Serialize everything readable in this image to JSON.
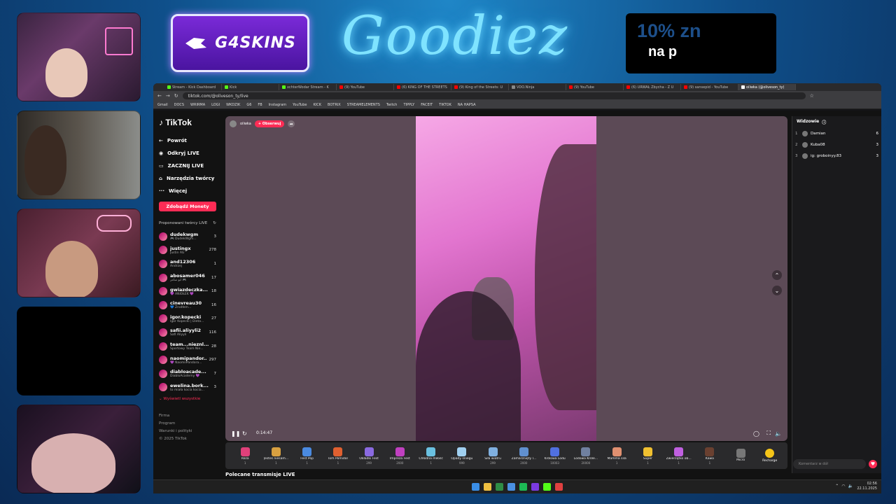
{
  "sponsor": {
    "brand": "G4SKINS"
  },
  "banner": {
    "title": "Goodiez"
  },
  "promo": {
    "line1": "10% zn",
    "line2": "na p"
  },
  "browser": {
    "tabs": [
      {
        "label": "Stream - Kick Dashboard",
        "color": "#53fc18"
      },
      {
        "label": "Kick",
        "color": "#53fc18"
      },
      {
        "label": "xchterWodar Stream - K",
        "color": "#53fc18"
      },
      {
        "label": "(9) YouTube",
        "color": "#ff0000"
      },
      {
        "label": "(6) KING OF THE STREETS",
        "color": "#ff0000"
      },
      {
        "label": "(9) King of the Streets: U",
        "color": "#ff0000"
      },
      {
        "label": "VDO.Ninja",
        "color": "#888888"
      },
      {
        "label": "(9) YouTube",
        "color": "#ff0000"
      },
      {
        "label": "(6) URWAŁ Zbycha - Z U",
        "color": "#ff0000"
      },
      {
        "label": "(9) sansepid - YouTube",
        "color": "#ff0000"
      },
      {
        "label": "oilwka (@oliveson_ty)",
        "color": "#ffffff",
        "active": true
      }
    ],
    "url": "tiktok.com/@oliveson_ty/live",
    "bookmarks": [
      "Gmail",
      "DOCS",
      "WRIRMA",
      "LOGI",
      "WKDZIK",
      "G6",
      "FB",
      "Instagram",
      "YouTube",
      "KICK",
      "BOTRIX",
      "STREAMELEMENTS",
      "Twitch",
      "TIPPLY",
      "FACEIT",
      "TIKTOK",
      "NA HAPSA"
    ]
  },
  "tiktok": {
    "logo": "TikTok",
    "nav": [
      {
        "icon": "←",
        "label": "Powrót"
      },
      {
        "icon": "◉",
        "label": "Odkryj LIVE"
      },
      {
        "icon": "▭",
        "label": "ZACZNIJ LIVE"
      },
      {
        "icon": "⌂",
        "label": "Narzędzia twórcy"
      },
      {
        "icon": "···",
        "label": "Więcej"
      }
    ],
    "coins_button": "Zdobądź Monety",
    "suggested_title": "Proponowani twórcy LIVE",
    "creators": [
      {
        "name": "dudekwgm",
        "sub": "🎮 DudekWgm...",
        "count": "3"
      },
      {
        "name": "justingx",
        "sub": "Justin AG",
        "count": "278"
      },
      {
        "name": "and12306",
        "sub": "Andrzej",
        "count": "1"
      },
      {
        "name": "abosamer046",
        "sub": "ابو سامر 🎮",
        "count": "17"
      },
      {
        "name": "gwiazdeczka...",
        "sub": "💜 ANIOŁEK 💜",
        "count": "18"
      },
      {
        "name": "cinevreau30",
        "sub": "💙 Zrodłem...",
        "count": "16"
      },
      {
        "name": "igor.kopecki",
        "sub": "Igor Kopecki | Dieta...",
        "count": "27"
      },
      {
        "name": "safii.aliyyli2",
        "sub": "Safi Aliyyli",
        "count": "116"
      },
      {
        "name": "team...nieznl...",
        "sub": "Sportowy Team Nie...",
        "count": "28"
      },
      {
        "name": "naomipandor...",
        "sub": "💜 NaomiiPandora...",
        "count": "297"
      },
      {
        "name": "diabloacade...",
        "sub": "DiabloAcademy 💜",
        "count": "7"
      },
      {
        "name": "ewelina.bork...",
        "sub": "to miała kocia kocia...",
        "count": "3"
      }
    ],
    "see_all": "⌄ Wyświetl wszystkie",
    "footer": [
      "Firma",
      "Program",
      "Warunki i polityki",
      "© 2025 TikTok"
    ],
    "host": {
      "name": "oilwka",
      "follow": "+ Obserwuj"
    },
    "time": "0:14:47",
    "gifts": [
      {
        "name": "Róża",
        "price": "1",
        "color": "#e0407a"
      },
      {
        "name": "Jesteś niesam...",
        "price": "1",
        "color": "#d8a040"
      },
      {
        "name": "Fest Pop",
        "price": "1",
        "color": "#4a8ae0"
      },
      {
        "name": "Tom Pomidor",
        "price": "1",
        "color": "#e06030"
      },
      {
        "name": "Okładki Fest",
        "price": "299",
        "color": "#8a6ae0"
      },
      {
        "name": "Impreza Fest",
        "price": "2000",
        "color": "#c040c0"
      },
      {
        "name": "Chłodna miłość",
        "price": "1",
        "color": "#6ac0e0"
      },
      {
        "name": "Opady śniegu",
        "price": "999",
        "color": "#a0d0f0"
      },
      {
        "name": "Siła wiatru",
        "price": "299",
        "color": "#80b0e0"
      },
      {
        "name": "Zamarznięty l...",
        "price": "2000",
        "color": "#6090d0"
      },
      {
        "name": "Królowa Lodu",
        "price": "10003",
        "color": "#5070e0"
      },
      {
        "name": "Lodowa Króle...",
        "price": "20000",
        "color": "#7080a0"
      },
      {
        "name": "Mamma sila",
        "price": "1",
        "color": "#e09070"
      },
      {
        "name": "Super",
        "price": "1",
        "color": "#f0c030"
      },
      {
        "name": "Zwierzątko ob...",
        "price": "1",
        "color": "#c060e0"
      },
      {
        "name": "Kawa",
        "price": "1",
        "color": "#6a4030"
      },
      {
        "name": "Micro",
        "price": "",
        "color": "#777777"
      }
    ],
    "recharge": "Recharge",
    "recommended": "Polecane transmisje LIVE",
    "viewers_title": "Widzowie",
    "viewers": [
      {
        "rank": "1",
        "name": "Damian",
        "count": "6"
      },
      {
        "rank": "2",
        "name": "Kuba08",
        "count": "3"
      },
      {
        "rank": "3",
        "name": "ig: groboinyy.83",
        "count": "3"
      }
    ],
    "comment_placeholder": "Komentarz w dół"
  },
  "taskbar": {
    "time": "02:56",
    "date": "22.11.2025",
    "apps": [
      "#3a8ee6",
      "#f0c040",
      "#2f8d46",
      "#4a90e2",
      "#1db954",
      "#7a3ae0",
      "#53fc18",
      "#e04040"
    ]
  }
}
